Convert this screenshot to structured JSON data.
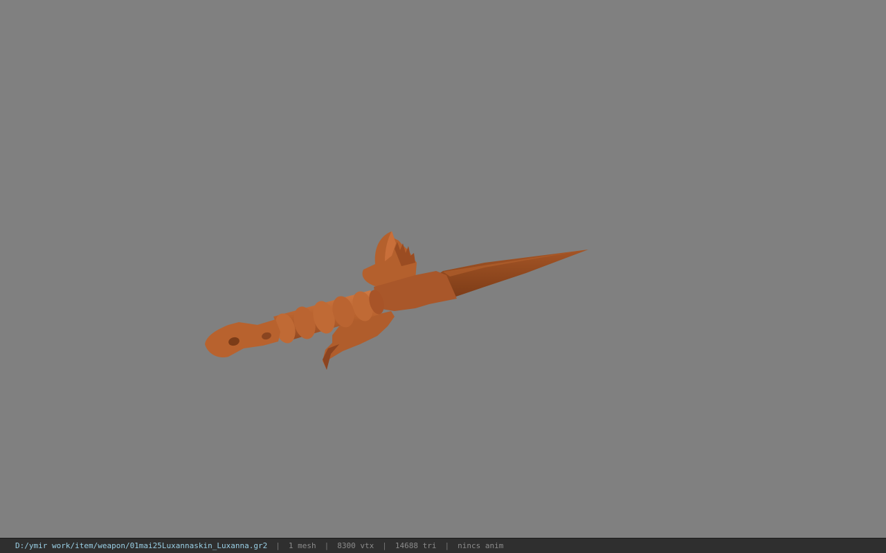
{
  "viewer": {
    "background_color": "#808080",
    "model_color": "#b8622e",
    "model_icon": "dagger-mesh"
  },
  "status": {
    "file_path": "D:/ymir work/item/weapon/01mai25Luxannaskin_Luxanna.gr2",
    "separator": "|",
    "mesh_count": "1 mesh",
    "vertex_count": "8300 vtx",
    "triangle_count": "14688 tri",
    "animation": "nincs anim"
  }
}
